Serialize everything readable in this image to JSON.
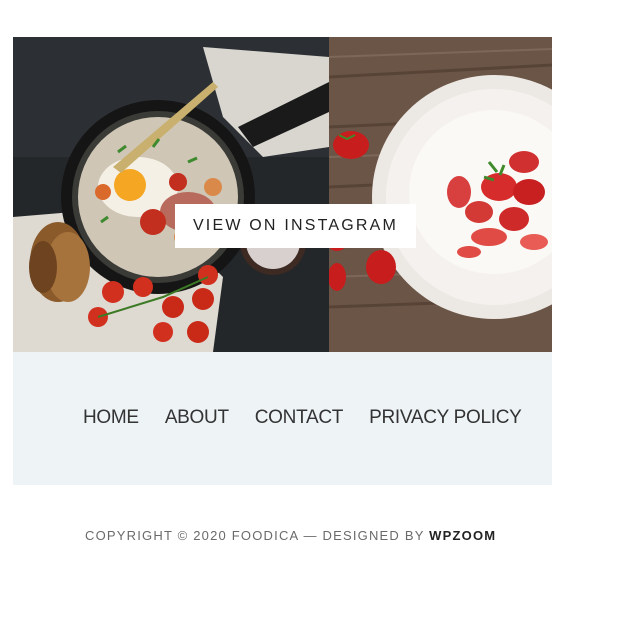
{
  "instagram": {
    "button_label": "VIEW ON INSTAGRAM",
    "images": [
      {
        "icon": "breakfast-pan-photo"
      },
      {
        "icon": "strawberry-pavlova-photo"
      }
    ]
  },
  "footer_nav": {
    "items": [
      {
        "label": "HOME"
      },
      {
        "label": "ABOUT"
      },
      {
        "label": "CONTACT"
      },
      {
        "label": "PRIVACY POLICY"
      }
    ]
  },
  "copyright": {
    "prefix": "COPYRIGHT © 2020 FOODICA — DESIGNED BY ",
    "brand": "WPZOOM"
  },
  "colors": {
    "footer_bg": "#eef3f6",
    "text_dark": "#333333",
    "text_muted": "#6a6a6a"
  }
}
